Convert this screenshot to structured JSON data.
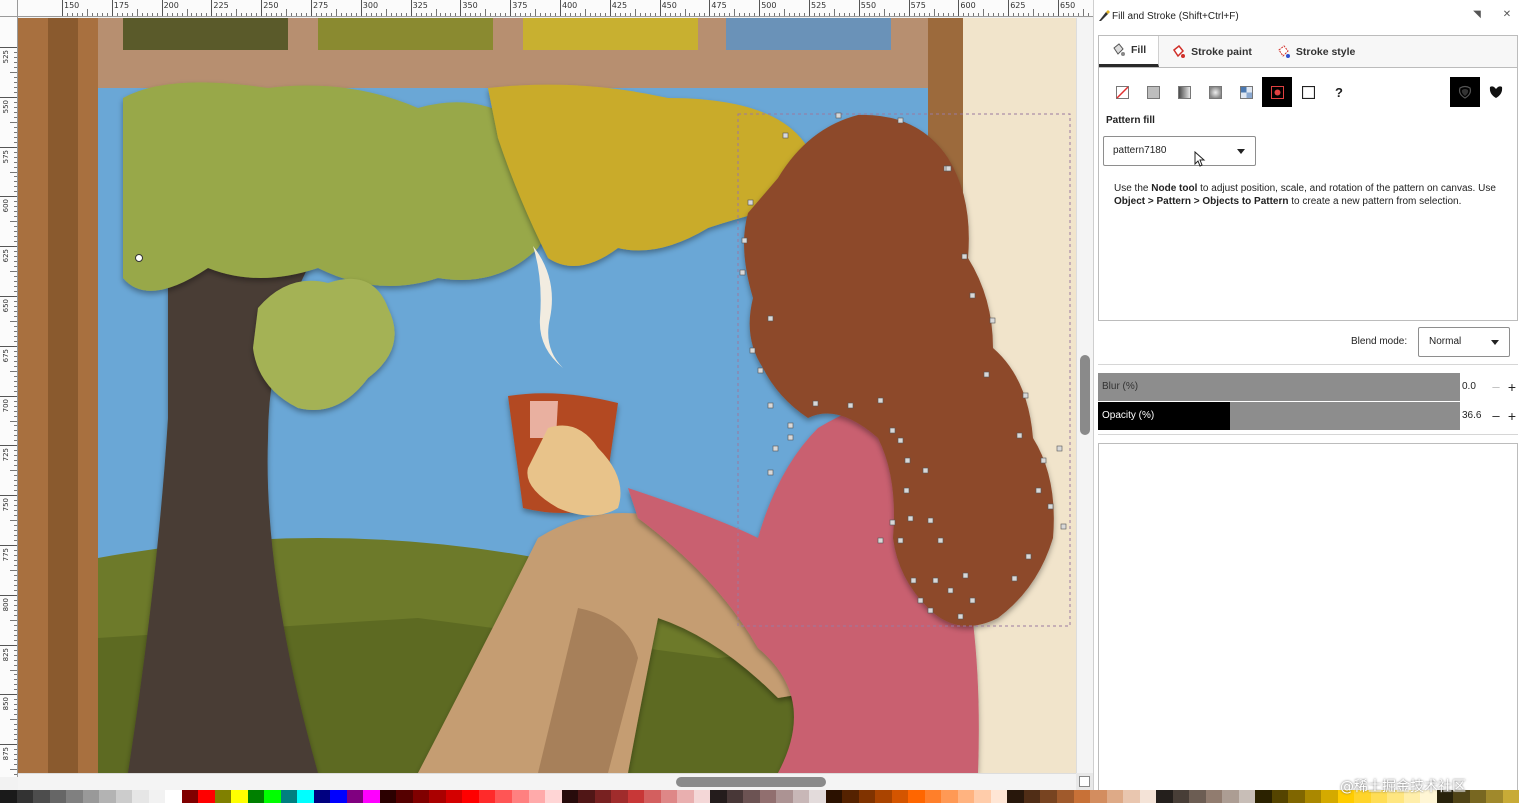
{
  "canvas": {
    "ruler_h_labels": [
      "150",
      "175",
      "200",
      "225",
      "250",
      "275",
      "300",
      "325",
      "350",
      "375",
      "400",
      "425",
      "450",
      "475",
      "500",
      "525",
      "550",
      "575",
      "600",
      "625",
      "650"
    ],
    "ruler_v_labels": [
      "525",
      "550",
      "575",
      "600",
      "625",
      "650",
      "675",
      "700",
      "725",
      "750",
      "775",
      "800",
      "825",
      "850",
      "875"
    ],
    "illustration": "paper-cut scene: girl with brown curly hair in pink sweater holding a red cup, tree with green canopy, blue sky window, wooden frame"
  },
  "dock": {
    "title": "Fill and Stroke (Shift+Ctrl+F)",
    "tabs": [
      {
        "label": "Fill",
        "icon": "fill-bucket-icon",
        "active": true
      },
      {
        "label": "Stroke paint",
        "icon": "stroke-paint-icon",
        "active": false
      },
      {
        "label": "Stroke style",
        "icon": "stroke-style-icon",
        "active": false
      }
    ],
    "fill_types": [
      {
        "name": "no-paint",
        "icon": "no-paint-icon",
        "active": false
      },
      {
        "name": "flat-color",
        "icon": "flat-color-icon",
        "active": false
      },
      {
        "name": "linear-gradient",
        "icon": "linear-gradient-icon",
        "active": false
      },
      {
        "name": "radial-gradient",
        "icon": "radial-gradient-icon",
        "active": false
      },
      {
        "name": "mesh-gradient",
        "icon": "mesh-gradient-icon",
        "active": false
      },
      {
        "name": "pattern",
        "icon": "pattern-icon",
        "active": true
      },
      {
        "name": "swatch",
        "icon": "swatch-icon",
        "active": false
      },
      {
        "name": "unset",
        "icon": "unset-paint-icon",
        "label": "?",
        "active": false
      }
    ],
    "fill_rule_icon": "fill-rule-evenodd-icon",
    "fill_rule_nonzero_icon": "fill-rule-nonzero-icon",
    "pattern": {
      "label": "Pattern fill",
      "selected": "pattern7180",
      "help_parts": [
        {
          "text": "Use the ",
          "bold": false
        },
        {
          "text": "Node tool",
          "bold": true
        },
        {
          "text": " to adjust position, scale, and rotation of the pattern on canvas. Use ",
          "bold": false
        },
        {
          "text": "Object > Pattern > Objects to Pattern",
          "bold": true
        },
        {
          "text": " to create a new pattern from selection.",
          "bold": false
        }
      ]
    },
    "blend": {
      "label": "Blend mode:",
      "value": "Normal"
    },
    "blur": {
      "label": "Blur (%)",
      "value": "0.0",
      "fraction": 0.0
    },
    "opacity": {
      "label": "Opacity (%)",
      "value": "36.6",
      "fraction": 0.366
    }
  },
  "palette_colors": [
    "#1a1a1a",
    "#333333",
    "#4d4d4d",
    "#666666",
    "#808080",
    "#999999",
    "#b3b3b3",
    "#cccccc",
    "#e6e6e6",
    "#f2f2f2",
    "#ffffff",
    "#800000",
    "#ff0000",
    "#808000",
    "#ffff00",
    "#008000",
    "#00ff00",
    "#008080",
    "#00ffff",
    "#000080",
    "#0000ff",
    "#800080",
    "#ff00ff",
    "#2b0000",
    "#550000",
    "#800000",
    "#aa0000",
    "#d40000",
    "#ff0000",
    "#ff2a2a",
    "#ff5555",
    "#ff8080",
    "#ffaaaa",
    "#ffd5d5",
    "#280b0b",
    "#501616",
    "#782121",
    "#a02c2c",
    "#c83737",
    "#d35f5f",
    "#de8787",
    "#e9afaf",
    "#f4d7d7",
    "#241c1c",
    "#483737",
    "#6c5353",
    "#916f6f",
    "#ac9393",
    "#c8b7b7",
    "#e3dbdb",
    "#2b1100",
    "#552200",
    "#803300",
    "#aa4400",
    "#d45500",
    "#ff6600",
    "#ff7f2a",
    "#ff9955",
    "#ffb380",
    "#ffccaa",
    "#ffe6d5",
    "#28170b",
    "#502d16",
    "#784421",
    "#a05a2c",
    "#c87137",
    "#d38d5f",
    "#deaa87",
    "#e9c6af",
    "#f4e3d7",
    "#241f1c",
    "#483e37",
    "#6c5d53",
    "#917c6f",
    "#ac9d93",
    "#c8beb7",
    "#2b2200",
    "#554400",
    "#806600",
    "#aa8800",
    "#d4aa00",
    "#ffcc00",
    "#ffd42a",
    "#ffdd55",
    "#ffe680",
    "#ffeeaa",
    "#fff6d5",
    "#28220b",
    "#504416",
    "#786721",
    "#a0892c",
    "#c8ab37"
  ],
  "watermark": "@稀土掘金技术社区"
}
